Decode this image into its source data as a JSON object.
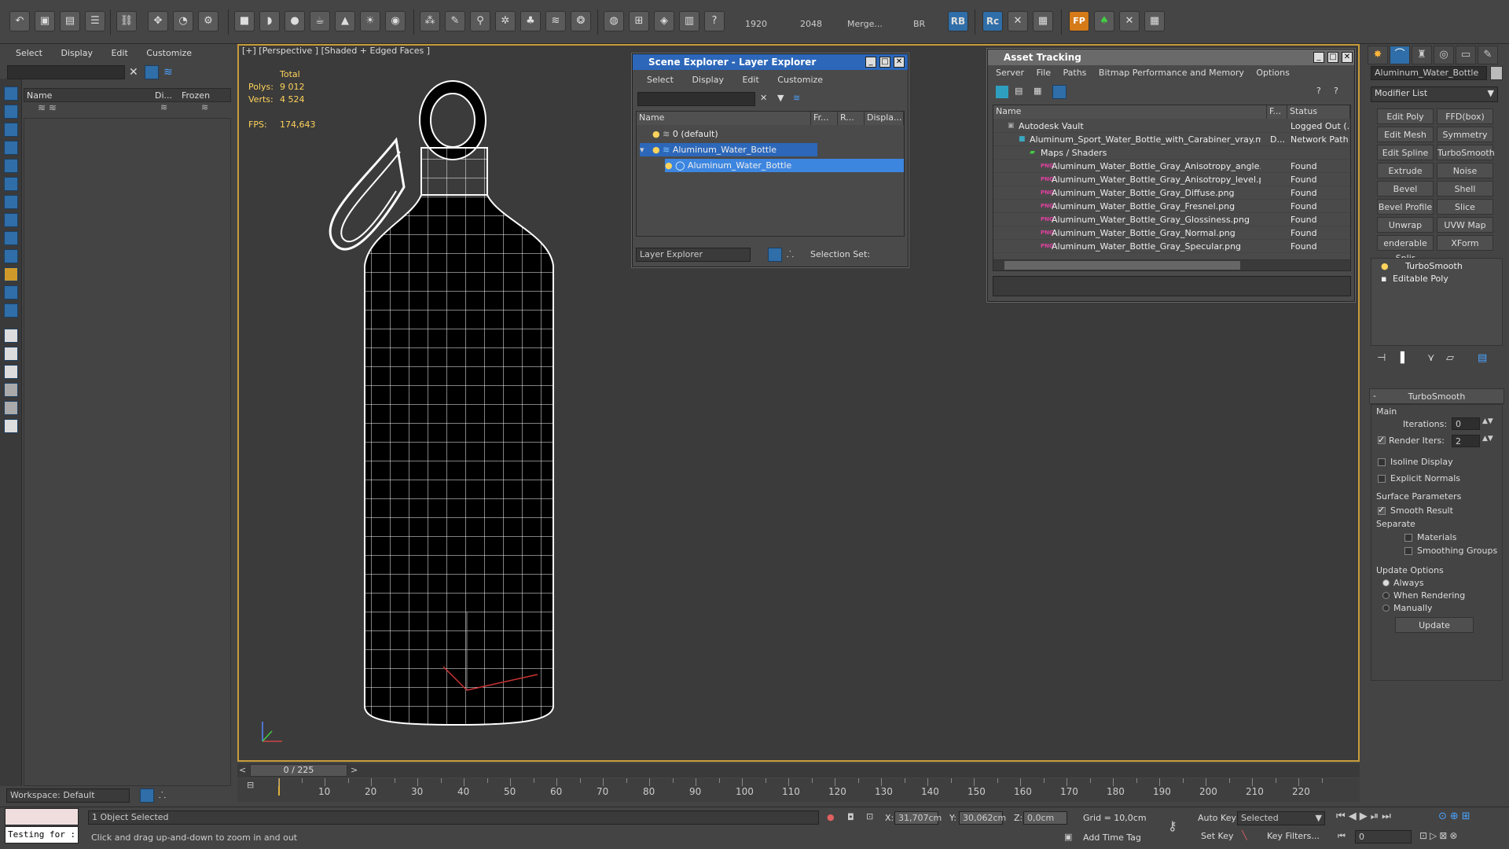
{
  "toolbar": {
    "width_value": "1920",
    "height_value": "2048",
    "merge_label": "Merge...",
    "br_label": "BR",
    "rb_label": "RB",
    "rc_label": "Rc",
    "fp_label": "FP"
  },
  "left_panel": {
    "menu": [
      "Select",
      "Display",
      "Edit",
      "Customize"
    ],
    "col_name": "Name",
    "col_display": "Di...",
    "col_frozen": "Frozen",
    "workspace": "Workspace: Default"
  },
  "viewport": {
    "label": "[+] [Perspective ] [Shaded + Edged Faces ]",
    "stats_total": "Total",
    "polys_label": "Polys:",
    "polys_value": "9 012",
    "verts_label": "Verts:",
    "verts_value": "4 524",
    "fps_label": "FPS:",
    "fps_value": "174,643"
  },
  "scene_explorer": {
    "title": "Scene Explorer - Layer Explorer",
    "menu": [
      "Select",
      "Display",
      "Edit",
      "Customize"
    ],
    "cols": [
      "Name",
      "Fr...",
      "R...",
      "Displa..."
    ],
    "rows": [
      {
        "name": "0 (default)",
        "level": 0
      },
      {
        "name": "Aluminum_Water_Bottle",
        "level": 0
      },
      {
        "name": "Aluminum_Water_Bottle",
        "level": 1
      }
    ],
    "footer_dropdown": "Layer Explorer",
    "selection_set": "Selection Set:"
  },
  "asset_tracking": {
    "title": "Asset Tracking",
    "menu": [
      "Server",
      "File",
      "Paths",
      "Bitmap Performance and Memory",
      "Options"
    ],
    "cols": [
      "Name",
      "F...",
      "Status"
    ],
    "rows": [
      {
        "name": "Autodesk Vault",
        "f": "",
        "status": "Logged Out (...",
        "indent": 0
      },
      {
        "name": "Aluminum_Sport_Water_Bottle_with_Carabiner_vray.max",
        "f": "D...",
        "status": "Network Path",
        "indent": 1
      },
      {
        "name": "Maps / Shaders",
        "f": "",
        "status": "",
        "indent": 2
      },
      {
        "name": "Aluminum_Water_Bottle_Gray_Anisotropy_angle.png",
        "f": "",
        "status": "Found",
        "indent": 3
      },
      {
        "name": "Aluminum_Water_Bottle_Gray_Anisotropy_level.png",
        "f": "",
        "status": "Found",
        "indent": 3
      },
      {
        "name": "Aluminum_Water_Bottle_Gray_Diffuse.png",
        "f": "",
        "status": "Found",
        "indent": 3
      },
      {
        "name": "Aluminum_Water_Bottle_Gray_Fresnel.png",
        "f": "",
        "status": "Found",
        "indent": 3
      },
      {
        "name": "Aluminum_Water_Bottle_Gray_Glossiness.png",
        "f": "",
        "status": "Found",
        "indent": 3
      },
      {
        "name": "Aluminum_Water_Bottle_Gray_Normal.png",
        "f": "",
        "status": "Found",
        "indent": 3
      },
      {
        "name": "Aluminum_Water_Bottle_Gray_Specular.png",
        "f": "",
        "status": "Found",
        "indent": 3
      }
    ],
    "png_badge": "PNG"
  },
  "command_panel": {
    "object_name": "Aluminum_Water_Bottle",
    "modifier_list": "Modifier List",
    "buttons": [
      "Edit Poly",
      "FFD(box)",
      "Edit Mesh",
      "Symmetry",
      "Edit Spline",
      "TurboSmooth",
      "Extrude",
      "Noise",
      "Bevel",
      "Shell",
      "Bevel Profile",
      "Slice",
      "Unwrap UVW",
      "UVW Map",
      "enderable Splir",
      "XForm"
    ],
    "stack": [
      "TurboSmooth",
      "Editable Poly"
    ],
    "rollout_title": "TurboSmooth",
    "main_label": "Main",
    "iterations_label": "Iterations:",
    "iterations_value": "0",
    "render_iters_label": "Render Iters:",
    "render_iters_value": "2",
    "isoline_label": "Isoline Display",
    "explicit_normals_label": "Explicit Normals",
    "surface_params_label": "Surface Parameters",
    "smooth_result_label": "Smooth Result",
    "separate_label": "Separate",
    "materials_label": "Materials",
    "smoothing_groups_label": "Smoothing Groups",
    "update_options_label": "Update Options",
    "always_label": "Always",
    "when_rendering_label": "When Rendering",
    "manually_label": "Manually",
    "update_button": "Update"
  },
  "timeline": {
    "frame_label": "0 / 225",
    "ticks": [
      "10",
      "20",
      "30",
      "40",
      "50",
      "60",
      "70",
      "80",
      "90",
      "100",
      "110",
      "120",
      "130",
      "140",
      "150",
      "160",
      "170",
      "180",
      "190",
      "200",
      "210",
      "220"
    ]
  },
  "status": {
    "maxscript": "Testing for :",
    "selection": "1 Object Selected",
    "prompt": "Click and drag up-and-down to zoom in and out",
    "x_label": "X:",
    "x_value": "31,707cm",
    "y_label": "Y:",
    "y_value": "30,062cm",
    "z_label": "Z:",
    "z_value": "0,0cm",
    "grid": "Grid = 10,0cm",
    "add_time_tag": "Add Time Tag",
    "auto_key": "Auto Key",
    "set_key": "Set Key",
    "selected": "Selected",
    "key_filters": "Key Filters...",
    "frame_value": "0"
  }
}
